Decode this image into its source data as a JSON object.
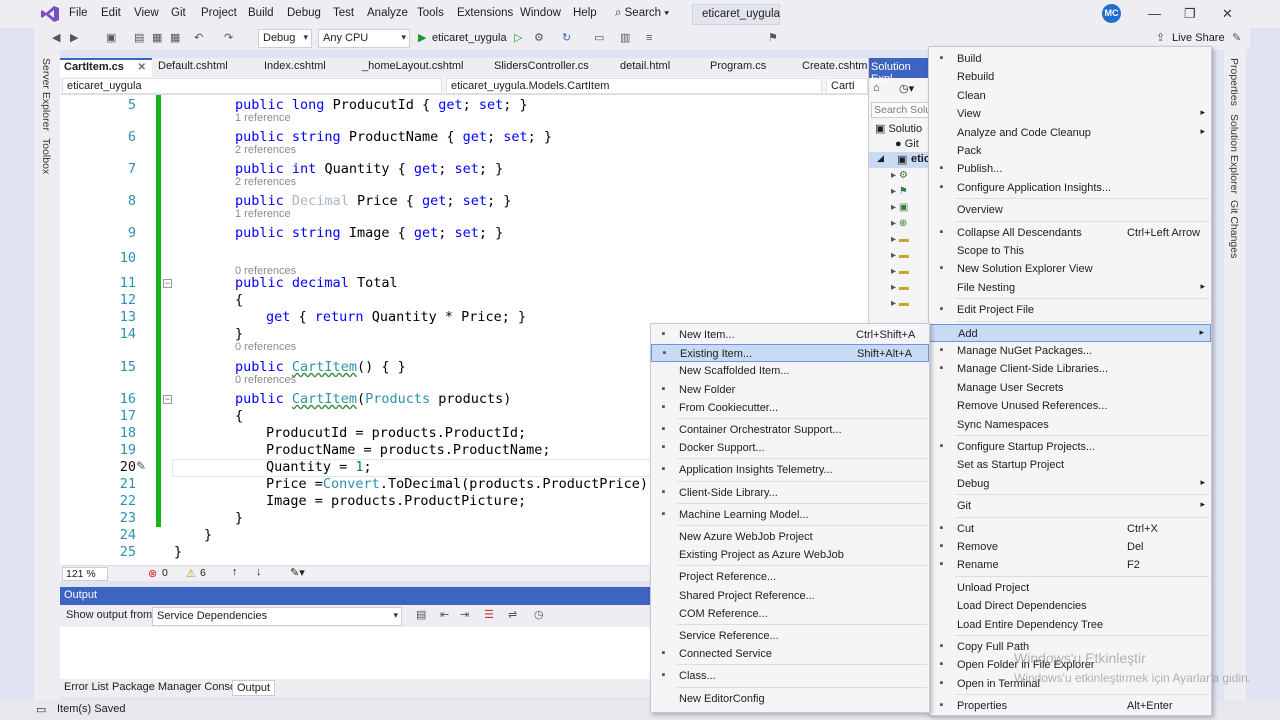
{
  "menubar": [
    "File",
    "Edit",
    "View",
    "Git",
    "Project",
    "Build",
    "Debug",
    "Test",
    "Analyze",
    "Tools",
    "Extensions",
    "Window",
    "Help"
  ],
  "search_label": "Search",
  "solution_title": "eticaret_uygula",
  "avatar_initials": "MC",
  "toolbar": {
    "config": "Debug",
    "platform": "Any CPU",
    "run_target": "eticaret_uygula",
    "live_share": "Live Share"
  },
  "side_tabs_left": [
    "Server Explorer",
    "Toolbox"
  ],
  "side_tabs_right": [
    "Properties",
    "Solution Explorer",
    "Git Changes"
  ],
  "tabs": [
    {
      "label": "CartItem.cs",
      "active": true
    },
    {
      "label": "Default.cshtml"
    },
    {
      "label": "Index.cshtml"
    },
    {
      "label": "_homeLayout.cshtml"
    },
    {
      "label": "SlidersController.cs"
    },
    {
      "label": "detail.html"
    },
    {
      "label": "Program.cs"
    },
    {
      "label": "Create.cshtml"
    }
  ],
  "navbar": {
    "project": "eticaret_uygula",
    "class": "eticaret_uygula.Models.CartItem",
    "member": "CartI"
  },
  "code_lines": [
    {
      "n": "5",
      "code": "public long ProducutId { get; set; }",
      "indent": 1,
      "refs": "1 reference"
    },
    {
      "n": "6",
      "code": "public string ProductName { get; set; }",
      "indent": 1,
      "refs": "2 references"
    },
    {
      "n": "7",
      "code": "public int Quantity { get; set; }",
      "indent": 1,
      "refs": "2 references"
    },
    {
      "n": "8",
      "code": "public Decimal Price { get; set; }",
      "indent": 1,
      "refs": "1 reference"
    },
    {
      "n": "9",
      "code": "public string Image { get; set; }",
      "indent": 1,
      "refs": ""
    },
    {
      "n": "10",
      "code": "",
      "indent": 1,
      "refs": "0 references"
    },
    {
      "n": "11",
      "code": "public decimal Total",
      "indent": 1,
      "refs": ""
    },
    {
      "n": "12",
      "code": "{",
      "indent": 1,
      "refs": ""
    },
    {
      "n": "13",
      "code": "get { return Quantity * Price; }",
      "indent": 2,
      "refs": ""
    },
    {
      "n": "14",
      "code": "}",
      "indent": 1,
      "refs": "0 references"
    },
    {
      "n": "15",
      "code": "public CartItem() { }",
      "indent": 1,
      "refs": "0 references"
    },
    {
      "n": "16",
      "code": "public CartItem(Products products)",
      "indent": 1,
      "refs": ""
    },
    {
      "n": "17",
      "code": "{",
      "indent": 1,
      "refs": ""
    },
    {
      "n": "18",
      "code": "ProducutId = products.ProductId;",
      "indent": 2,
      "refs": ""
    },
    {
      "n": "19",
      "code": "ProductName = products.ProductName;",
      "indent": 2,
      "refs": ""
    },
    {
      "n": "20",
      "code": "Quantity = 1;",
      "indent": 2,
      "refs": ""
    },
    {
      "n": "21",
      "code": "Price =Convert.ToDecimal(products.ProductPrice);",
      "indent": 2,
      "refs": ""
    },
    {
      "n": "22",
      "code": "Image = products.ProductPicture;",
      "indent": 2,
      "refs": ""
    },
    {
      "n": "23",
      "code": "}",
      "indent": 1,
      "refs": ""
    },
    {
      "n": "24",
      "code": "}",
      "indent": 0,
      "refs": ""
    },
    {
      "n": "25",
      "code": "}",
      "indent": -1,
      "refs": ""
    }
  ],
  "editor_status": {
    "zoom": "121 %",
    "errors": "0",
    "warnings": "6"
  },
  "output": {
    "title": "Output",
    "show_from_label": "Show output from:",
    "source": "Service Dependencies"
  },
  "bottom_tabs": [
    "Error List",
    "Package Manager Console",
    "Output"
  ],
  "status_text": "Item(s) Saved",
  "solution_explorer": {
    "title": "Solution Expl",
    "search": "Search Solut",
    "items": [
      "Solutio",
      "Git",
      "etic"
    ]
  },
  "context_menu": [
    {
      "label": "Build",
      "icon": "build-icon"
    },
    {
      "label": "Rebuild"
    },
    {
      "label": "Clean"
    },
    {
      "label": "View",
      "submenu": true
    },
    {
      "label": "Analyze and Code Cleanup",
      "submenu": true
    },
    {
      "label": "Pack"
    },
    {
      "label": "Publish...",
      "icon": "globe-icon"
    },
    {
      "label": "Configure Application Insights...",
      "icon": "insights-icon"
    },
    {
      "sep": true
    },
    {
      "label": "Overview"
    },
    {
      "sep": true
    },
    {
      "label": "Collapse All Descendants",
      "shortcut": "Ctrl+Left Arrow",
      "icon": "collapse-icon"
    },
    {
      "label": "Scope to This"
    },
    {
      "label": "New Solution Explorer View",
      "icon": "new-view-icon"
    },
    {
      "label": "File Nesting",
      "submenu": true
    },
    {
      "sep": true
    },
    {
      "label": "Edit Project File",
      "icon": "refresh-icon"
    },
    {
      "sep": true
    },
    {
      "label": "Add",
      "submenu": true,
      "highlight": true
    },
    {
      "label": "Manage NuGet Packages...",
      "icon": "nuget-icon"
    },
    {
      "label": "Manage Client-Side Libraries...",
      "icon": "library-icon"
    },
    {
      "label": "Manage User Secrets"
    },
    {
      "label": "Remove Unused References..."
    },
    {
      "label": "Sync Namespaces"
    },
    {
      "sep": true
    },
    {
      "label": "Configure Startup Projects...",
      "icon": "gear-icon"
    },
    {
      "label": "Set as Startup Project"
    },
    {
      "label": "Debug",
      "submenu": true
    },
    {
      "sep": true
    },
    {
      "label": "Git",
      "submenu": true
    },
    {
      "sep": true
    },
    {
      "label": "Cut",
      "shortcut": "Ctrl+X",
      "icon": "cut-icon"
    },
    {
      "label": "Remove",
      "shortcut": "Del",
      "icon": "remove-icon"
    },
    {
      "label": "Rename",
      "shortcut": "F2",
      "icon": "rename-icon"
    },
    {
      "sep": true
    },
    {
      "label": "Unload Project"
    },
    {
      "label": "Load Direct Dependencies"
    },
    {
      "label": "Load Entire Dependency Tree"
    },
    {
      "sep": true
    },
    {
      "label": "Copy Full Path",
      "icon": "copy-icon"
    },
    {
      "label": "Open Folder in File Explorer",
      "icon": "refresh-icon"
    },
    {
      "label": "Open in Terminal",
      "icon": "terminal-icon"
    },
    {
      "sep": true
    },
    {
      "label": "Properties",
      "shortcut": "Alt+Enter",
      "icon": "wrench-icon"
    }
  ],
  "add_submenu": [
    {
      "label": "New Item...",
      "shortcut": "Ctrl+Shift+A",
      "icon": "new-item-icon"
    },
    {
      "label": "Existing Item...",
      "shortcut": "Shift+Alt+A",
      "icon": "existing-item-icon",
      "highlight": true
    },
    {
      "label": "New Scaffolded Item..."
    },
    {
      "label": "New Folder",
      "icon": "folder-icon"
    },
    {
      "label": "From Cookiecutter...",
      "icon": "cookie-icon"
    },
    {
      "sep": true
    },
    {
      "label": "Container Orchestrator Support...",
      "icon": "container-icon"
    },
    {
      "label": "Docker Support...",
      "icon": "docker-icon"
    },
    {
      "sep": true
    },
    {
      "label": "Application Insights Telemetry...",
      "icon": "insights-icon"
    },
    {
      "sep": true
    },
    {
      "label": "Client-Side Library...",
      "icon": "library-icon"
    },
    {
      "sep": true
    },
    {
      "label": "Machine Learning Model...",
      "icon": "ml-icon"
    },
    {
      "sep": true
    },
    {
      "label": "New Azure WebJob Project"
    },
    {
      "label": "Existing Project as Azure WebJob"
    },
    {
      "sep": true
    },
    {
      "label": "Project Reference..."
    },
    {
      "label": "Shared Project Reference..."
    },
    {
      "label": "COM Reference..."
    },
    {
      "sep": true
    },
    {
      "label": "Service Reference..."
    },
    {
      "label": "Connected Service",
      "icon": "connected-icon"
    },
    {
      "sep": true
    },
    {
      "label": "Class...",
      "icon": "class-icon"
    },
    {
      "sep": true
    },
    {
      "label": "New EditorConfig"
    }
  ],
  "watermark": [
    "Windows'u Etkinleştir",
    "Windows'u etkinleştirmek için Ayarlar'a gidin."
  ]
}
